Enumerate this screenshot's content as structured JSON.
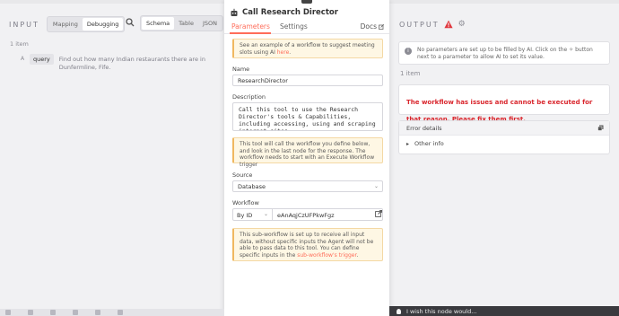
{
  "input": {
    "title": "INPUT",
    "mode_tabs": [
      "Mapping",
      "Debugging"
    ],
    "active_mode": "Debugging",
    "view_tabs": [
      "Schema",
      "Table",
      "JSON"
    ],
    "active_view": "Schema",
    "item_count": "1 item",
    "field_type": "A",
    "field_key": "query",
    "field_value": "Find out how many Indian restaurants there are in Dunfermline, Fife."
  },
  "modal": {
    "title": "Call Research Director",
    "tabs": [
      "Parameters",
      "Settings"
    ],
    "active_tab": "Parameters",
    "docs_label": "Docs",
    "example_note_prefix": "See an example of a workflow to suggest meeting slots using AI ",
    "example_note_link": "here",
    "example_note_suffix": ".",
    "name_label": "Name",
    "name_value": "ResearchDirector",
    "description_label": "Description",
    "description_value": "Call this tool to use the Research Director's tools & Capabilities, including accessing, using and scraping internet sites",
    "tool_note": "This tool will call the workflow you define below, and look in the last node for the response. The workflow needs to start with an Execute Workflow trigger",
    "source_label": "Source",
    "source_value": "Database",
    "workflow_label": "Workflow",
    "workflow_mode": "By ID",
    "workflow_id": "eAnAqjCzUFPkwFgz",
    "subworkflow_note_prefix": "This sub-workflow is set up to receive all input data, without specific inputs the Agent will not be able to pass data to this tool. You can define specific inputs in the ",
    "subworkflow_note_link": "sub-workflow's trigger",
    "subworkflow_note_suffix": "."
  },
  "output": {
    "title": "OUTPUT",
    "info_text": "No parameters are set up to be filled by AI. Click on the ✧ button next to a parameter to allow AI to set its value.",
    "item_count": "1 item",
    "error_text": "The workflow has issues and cannot be executed for that reason. Please fix them first.",
    "details_label": "Error details",
    "other_info_label": "Other info"
  },
  "footer": {
    "wish_text": "I wish this node would..."
  },
  "colors": {
    "accent": "#ff6d5a",
    "error": "#d9262d",
    "note_bg": "#fef7e4"
  }
}
